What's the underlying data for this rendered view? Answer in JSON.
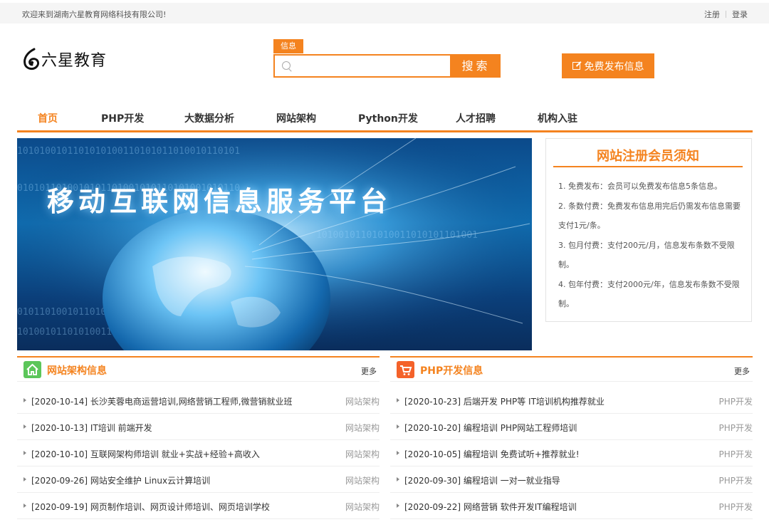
{
  "topbar": {
    "welcome": "欢迎来到湖南六星教育网络科技有限公司!",
    "register": "注册",
    "login": "登录"
  },
  "logo": {
    "text": "六星教育"
  },
  "search": {
    "tag": "信息",
    "placeholder": "",
    "button": "搜索"
  },
  "publish_button": "免费发布信息",
  "nav": {
    "items": [
      {
        "label": "首页",
        "active": true
      },
      {
        "label": "PHP开发",
        "active": false
      },
      {
        "label": "大数据分析",
        "active": false
      },
      {
        "label": "网站架构",
        "active": false
      },
      {
        "label": "Python开发",
        "active": false
      },
      {
        "label": "人才招聘",
        "active": false
      },
      {
        "label": "机构入驻",
        "active": false
      }
    ]
  },
  "banner": {
    "title": "移动互联网信息服务平台"
  },
  "notice": {
    "title": "网站注册会员须知",
    "rules": [
      "1. 免费发布：会员可以免费发布信息5条信息。",
      "2. 条数付费：免费发布信息用完后仍需发布信息需要支付1元/条。",
      "3. 包月付费：支付200元/月，信息发布条数不受限制。",
      "4. 包年付费：支付2000元/年，信息发布条数不受限制。"
    ]
  },
  "blocks": [
    {
      "title": "网站架构信息",
      "more": "更多",
      "icon": "home-icon",
      "items": [
        {
          "text": "[2020-10-14]  长沙芙蓉电商运营培训,网络营销工程师,微营销就业班",
          "cat": "网站架构"
        },
        {
          "text": "[2020-10-13]  IT培训 前端开发",
          "cat": "网站架构"
        },
        {
          "text": "[2020-10-10]  互联网架构师培训 就业+实战+经验+高收入",
          "cat": "网站架构"
        },
        {
          "text": "[2020-09-26]  网站安全维护 Linux云计算培训",
          "cat": "网站架构"
        },
        {
          "text": "[2020-09-19]  网页制作培训、网页设计师培训、网页培训学校",
          "cat": "网站架构"
        }
      ]
    },
    {
      "title": "PHP开发信息",
      "more": "更多",
      "icon": "cart-icon",
      "items": [
        {
          "text": "[2020-10-23]  后端开发 PHP等 IT培训机构推荐就业",
          "cat": "PHP开发"
        },
        {
          "text": "[2020-10-20]  编程培训 PHP网站工程师培训",
          "cat": "PHP开发"
        },
        {
          "text": "[2020-10-05]  编程培训 免费试听+推荐就业!",
          "cat": "PHP开发"
        },
        {
          "text": "[2020-09-30]  编程培训 一对一就业指导",
          "cat": "PHP开发"
        },
        {
          "text": "[2020-09-22]  网络营销 软件开发IT编程培训",
          "cat": "PHP开发"
        }
      ]
    }
  ],
  "colors": {
    "accent": "#f4831f",
    "home_icon_bg": "#5cc65a",
    "cart_icon_bg": "#f4622a"
  }
}
